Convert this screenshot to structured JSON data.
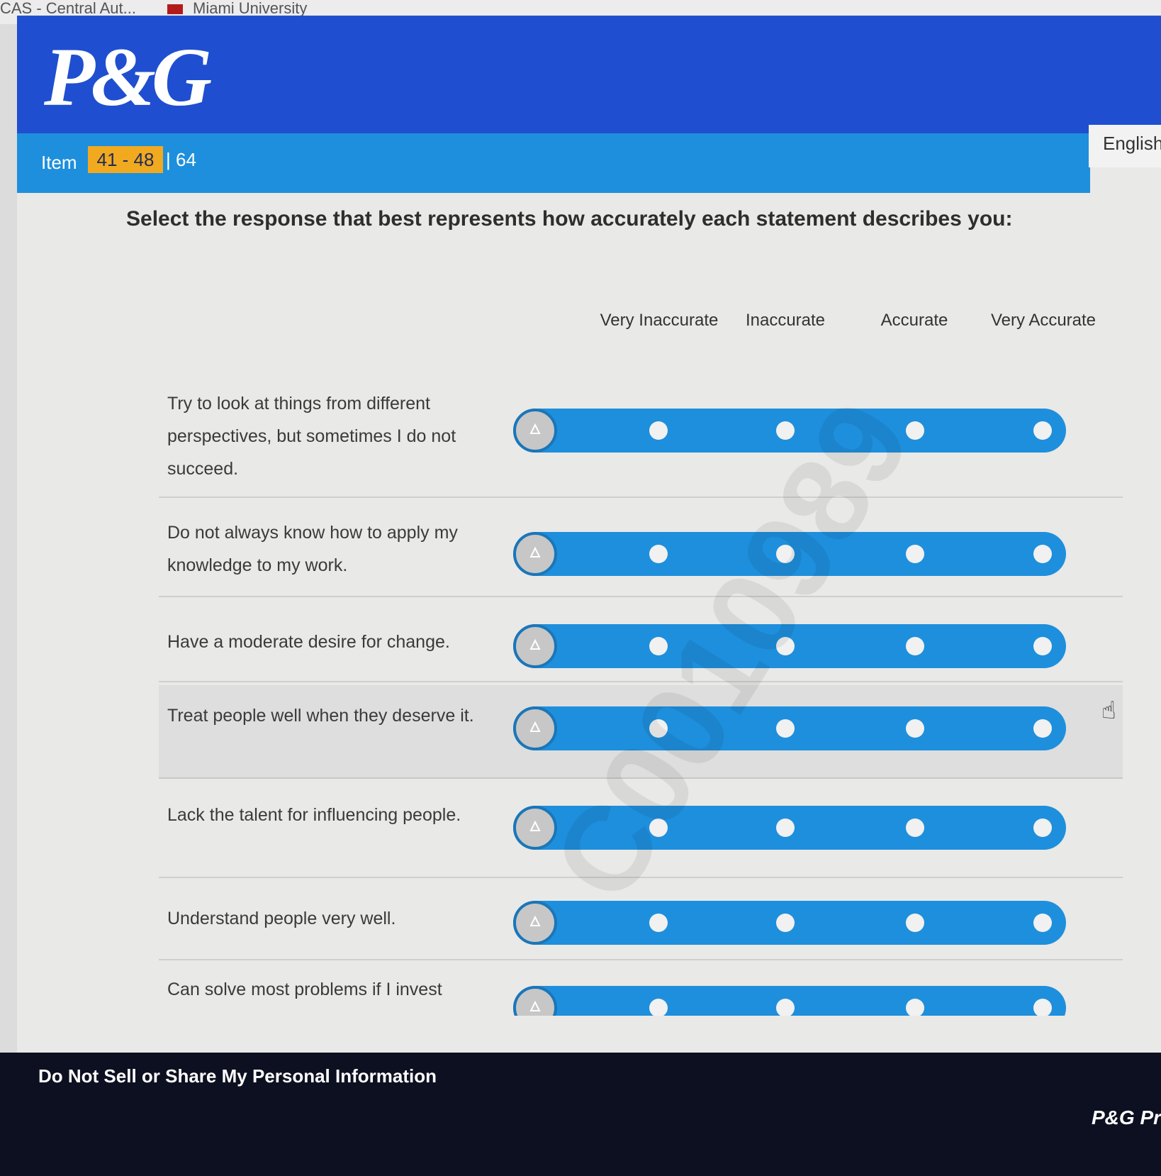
{
  "browser": {
    "bookmarks": [
      {
        "label": "CAS - Central Aut..."
      },
      {
        "label": "Miami University"
      }
    ]
  },
  "header": {
    "logo_text": "P&G",
    "item_label": "Item",
    "item_range": "41 - 48",
    "item_total": "| 64",
    "language": "English"
  },
  "survey": {
    "instruction": "Select the response that best represents how accurately each statement describes you:",
    "scale": [
      "Very Inaccurate",
      "Inaccurate",
      "Accurate",
      "Very Accurate"
    ],
    "watermark": "C0010989",
    "questions": [
      {
        "text": "Try to look at things from different perspectives, but sometimes I do not succeed."
      },
      {
        "text": "Do not always know how to apply my knowledge to my work."
      },
      {
        "text": "Have a moderate desire for change."
      },
      {
        "text": "Treat people well when they deserve it."
      },
      {
        "text": "Lack the talent for influencing people."
      },
      {
        "text": "Understand people very well."
      },
      {
        "text": "Can solve most problems if I invest"
      }
    ]
  },
  "footer": {
    "privacy_link": "Do Not Sell or Share My Personal Information",
    "brand": "P&G Pr"
  },
  "colors": {
    "header_blue": "#1f4fd0",
    "item_bar_blue": "#1e8fdc",
    "range_badge": "#f1a920",
    "footer": "#0d1020"
  }
}
